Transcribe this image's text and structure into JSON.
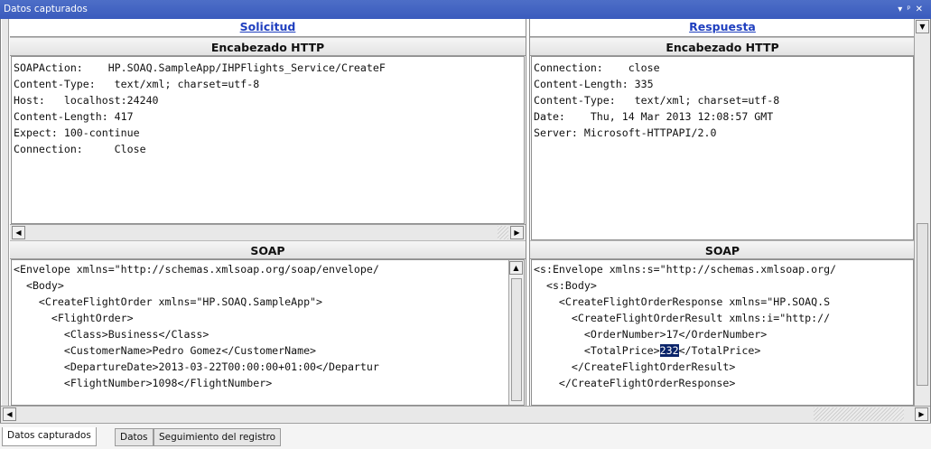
{
  "window": {
    "title": "Datos capturados",
    "icons": "▾ ⊕ ✕"
  },
  "request": {
    "header_link": "Solicitud",
    "http_title": "Encabezado HTTP",
    "http_lines": [
      "SOAPAction:    HP.SOAQ.SampleApp/IHPFlights_Service/CreateF",
      "Content-Type:   text/xml; charset=utf-8",
      "Host:   localhost:24240",
      "Content-Length: 417",
      "Expect: 100-continue",
      "Connection:     Close"
    ],
    "soap_title": "SOAP",
    "soap_lines": [
      "<Envelope xmlns=\"http://schemas.xmlsoap.org/soap/envelope/",
      "  <Body>",
      "    <CreateFlightOrder xmlns=\"HP.SOAQ.SampleApp\">",
      "      <FlightOrder>",
      "        <Class>Business</Class>",
      "        <CustomerName>Pedro Gomez</CustomerName>",
      "        <DepartureDate>2013-03-22T00:00:00+01:00</Departur",
      "        <FlightNumber>1098</FlightNumber>"
    ]
  },
  "response": {
    "header_link": "Respuesta",
    "http_title": "Encabezado HTTP",
    "http_lines": [
      "Connection:    close",
      "Content-Length: 335",
      "Content-Type:   text/xml; charset=utf-8",
      "Date:    Thu, 14 Mar 2013 12:08:57 GMT",
      "Server: Microsoft-HTTPAPI/2.0"
    ],
    "soap_title": "SOAP",
    "soap_lines": [
      "<s:Envelope xmlns:s=\"http://schemas.xmlsoap.org/",
      "  <s:Body>",
      "    <CreateFlightOrderResponse xmlns=\"HP.SOAQ.S",
      "      <CreateFlightOrderResult xmlns:i=\"http://",
      "        <OrderNumber>17</OrderNumber>",
      "        <TotalPrice>",
      "      </CreateFlightOrderResult>",
      "    </CreateFlightOrderResponse>"
    ],
    "highlight_value": "232",
    "highlight_suffix": "</TotalPrice>"
  },
  "tabs": [
    {
      "label": "Datos capturados",
      "active": true
    },
    {
      "label": "Datos",
      "active": false
    },
    {
      "label": "Seguimiento del registro",
      "active": false
    }
  ],
  "colors": {
    "titlebar": "#3a5bbd",
    "link": "#1f3fbf",
    "highlight": "#0a246a"
  }
}
